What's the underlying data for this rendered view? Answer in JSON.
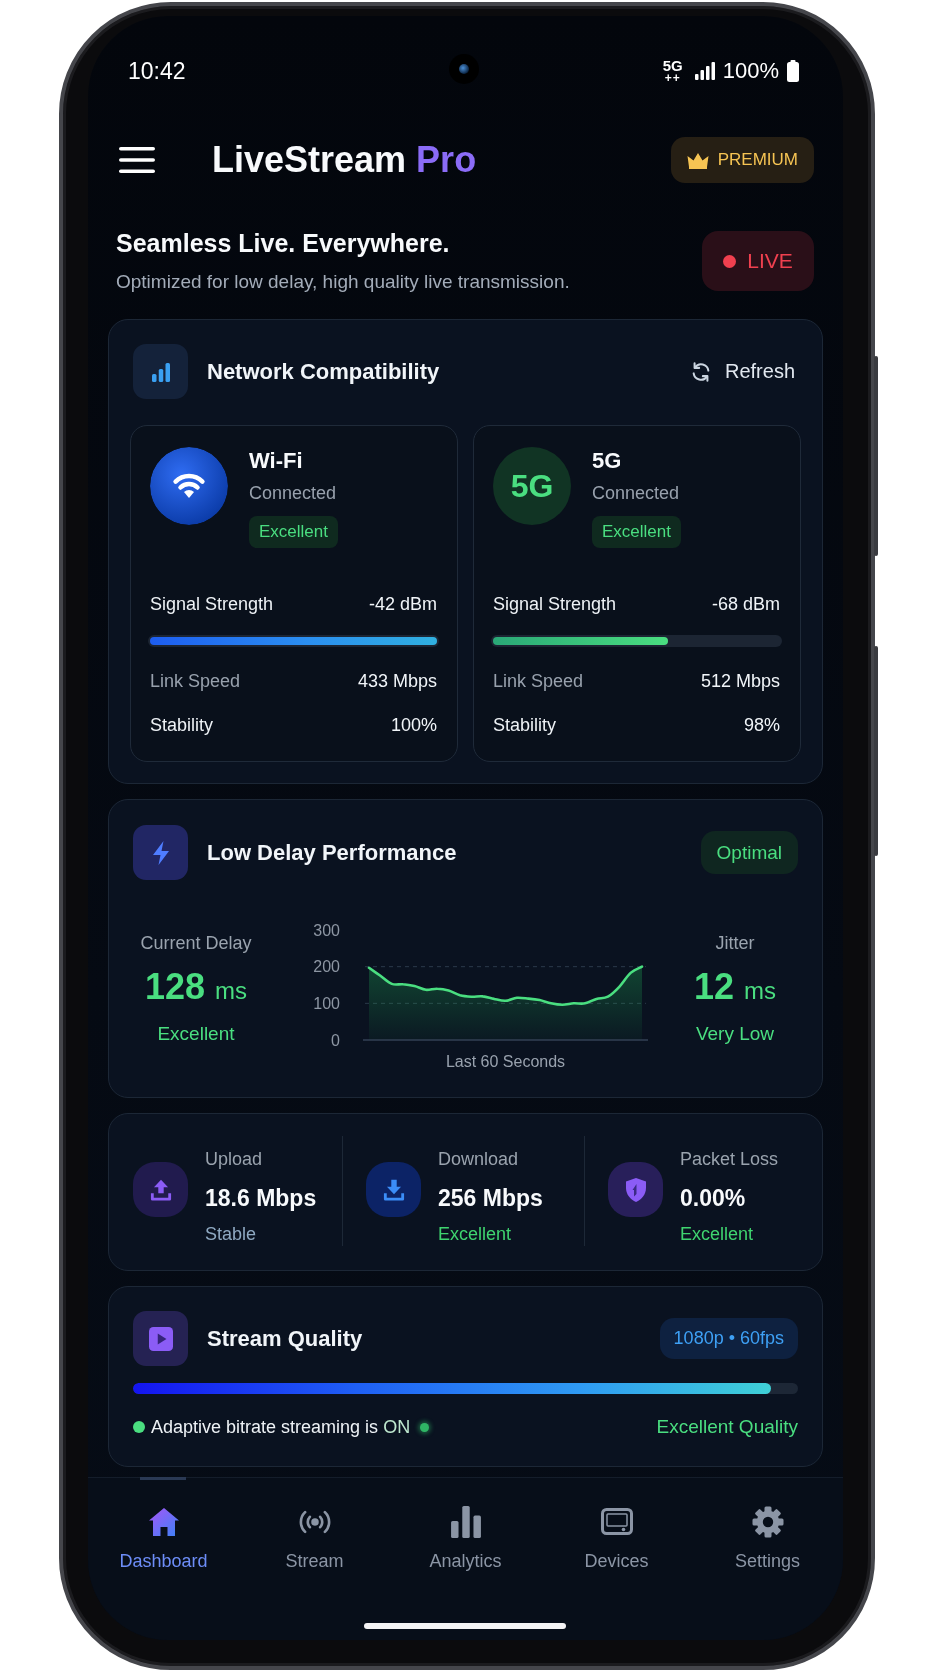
{
  "status_bar": {
    "time": "10:42",
    "network": "5G",
    "network_sub": "++",
    "battery": "100%"
  },
  "header": {
    "title": "LiveStream",
    "title_accent": "Pro",
    "premium": "PREMIUM"
  },
  "hero": {
    "heading": "Seamless Live. Everywhere.",
    "subtitle": "Optimized for low delay, high quality live transmission.",
    "live": "LIVE"
  },
  "network": {
    "title": "Network Compatibility",
    "refresh": "Refresh",
    "connections": [
      {
        "kind": "wifi",
        "name": "Wi-Fi",
        "status": "Connected",
        "quality": "Excellent",
        "signal_label": "Signal Strength",
        "signal": "-42 dBm",
        "level": 1,
        "stats": [
          {
            "label": "Link Speed",
            "value": "433 Mbps"
          },
          {
            "label": "Stability",
            "value": "100%"
          }
        ]
      },
      {
        "kind": "cellular",
        "badge": "5G",
        "name": "5G",
        "status": "Connected",
        "quality": "Excellent",
        "signal_label": "Signal Strength",
        "signal": "-68 dBm",
        "level": 0.61,
        "stats": [
          {
            "label": "Link Speed",
            "value": "512 Mbps"
          },
          {
            "label": "Stability",
            "value": "98%"
          }
        ]
      }
    ]
  },
  "delay": {
    "title": "Low Delay Performance",
    "badge": "Optimal",
    "current": {
      "label": "Current Delay",
      "value": "128",
      "unit": "ms",
      "rating": "Excellent"
    },
    "jitter": {
      "label": "Jitter",
      "value": "12",
      "unit": "ms",
      "rating": "Very Low"
    },
    "chart_data": {
      "type": "area",
      "xlabel": "Last 60 Seconds",
      "categories": [
        null,
        null,
        null,
        null,
        null,
        null,
        null,
        null,
        null,
        null,
        null,
        null,
        null,
        null,
        null,
        null,
        null,
        null,
        null,
        null,
        null,
        null,
        null,
        null,
        null
      ],
      "values": [
        197,
        175,
        153,
        152,
        147,
        137,
        140,
        135,
        122,
        118,
        119,
        112,
        107,
        115,
        113,
        109,
        100,
        96,
        100,
        100,
        112,
        118,
        145,
        183,
        200
      ],
      "ylim": [
        0,
        300
      ],
      "yticks": [
        0,
        100,
        200,
        300
      ]
    }
  },
  "metrics": [
    {
      "kind": "upload",
      "label": "Upload",
      "value": "18.6 Mbps",
      "status": "Stable",
      "color": "#8fa9c2"
    },
    {
      "kind": "download",
      "label": "Download",
      "value": "256 Mbps",
      "status": "Excellent",
      "color": "#3fd46f"
    },
    {
      "kind": "shield",
      "label": "Packet Loss",
      "value": "0.00%",
      "status": "Excellent",
      "color": "#3fd46f"
    }
  ],
  "quality": {
    "title": "Stream Quality",
    "badge": "1080p • 60fps",
    "level": 0.96,
    "adaptive": {
      "label": "Adaptive bitrate streaming is",
      "value": "ON",
      "on": true
    },
    "rating": "Excellent Quality"
  },
  "nav": [
    {
      "kind": "home",
      "label": "Dashboard",
      "selected": true
    },
    {
      "kind": "broadcast",
      "label": "Stream",
      "selected": false
    },
    {
      "kind": "chart",
      "label": "Analytics",
      "selected": false
    },
    {
      "kind": "device",
      "label": "Devices",
      "selected": false
    },
    {
      "kind": "settings",
      "label": "Settings",
      "selected": false
    }
  ]
}
